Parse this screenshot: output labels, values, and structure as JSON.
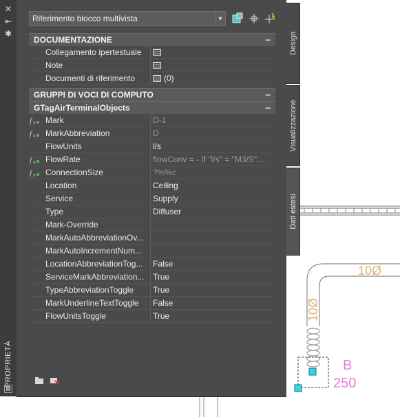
{
  "panel": {
    "vertical_title": "PROPRIETÀ",
    "selector_value": "Riferimento blocco multivista"
  },
  "tabs": [
    {
      "label": "Design"
    },
    {
      "label": "Visualizzazione"
    },
    {
      "label": "Dati estesi"
    }
  ],
  "sections": {
    "documentazione": {
      "title": "DOCUMENTAZIONE",
      "rows": [
        {
          "label": "Collegamento ipertestuale",
          "value": ""
        },
        {
          "label": "Note",
          "value": ""
        },
        {
          "label": "Documenti di riferimento",
          "value": "(0)"
        }
      ]
    },
    "gruppi": {
      "title": "GRUPPI DI VOCI DI COMPUTO"
    },
    "gtag": {
      "title": "GTagAirTerminalObjects",
      "rows": [
        {
          "label": "Mark",
          "value": "D-1",
          "formula": true
        },
        {
          "label": "MarkAbbreviation",
          "value": "D",
          "formula": true
        },
        {
          "label": "FlowUnits",
          "value": "l/s",
          "formula": false
        },
        {
          "label": "FlowRate",
          "value": "flowConv = - If \"l/s\" = \"M3/S\"...",
          "formula": true
        },
        {
          "label": "ConnectionSize",
          "value": "?%%c",
          "formula": true
        },
        {
          "label": "Location",
          "value": "Ceiling",
          "formula": false
        },
        {
          "label": "Service",
          "value": "Supply",
          "formula": false
        },
        {
          "label": "Type",
          "value": "Diffuser",
          "formula": false
        },
        {
          "label": "Mark-Override",
          "value": "",
          "formula": false
        },
        {
          "label": "MarkAutoAbbreviationOv...",
          "value": "",
          "formula": false
        },
        {
          "label": "MarkAutoIncrementNum...",
          "value": "",
          "formula": false
        },
        {
          "label": "LocationAbbreviationTog...",
          "value": "False",
          "formula": false
        },
        {
          "label": "ServiceMarkAbbreviation...",
          "value": "True",
          "formula": false
        },
        {
          "label": "TypeAbbreviationToggle",
          "value": "True",
          "formula": false
        },
        {
          "label": "MarkUnderlineTextToggle",
          "value": "False",
          "formula": false
        },
        {
          "label": "FlowUnitsToggle",
          "value": "True",
          "formula": false
        }
      ]
    }
  },
  "drawing": {
    "duct_label_horizontal": "10Ø",
    "duct_label_vertical": "10Ø",
    "tag_letter": "B",
    "tag_value": "250"
  },
  "colors": {
    "panel_bg": "#4a4a4a",
    "section_bg": "#5a5a5a",
    "duct_line": "#8c8c8c",
    "tag_text": "#e87be0",
    "label_text": "#e0b07a",
    "grip": "#33d6e6"
  }
}
